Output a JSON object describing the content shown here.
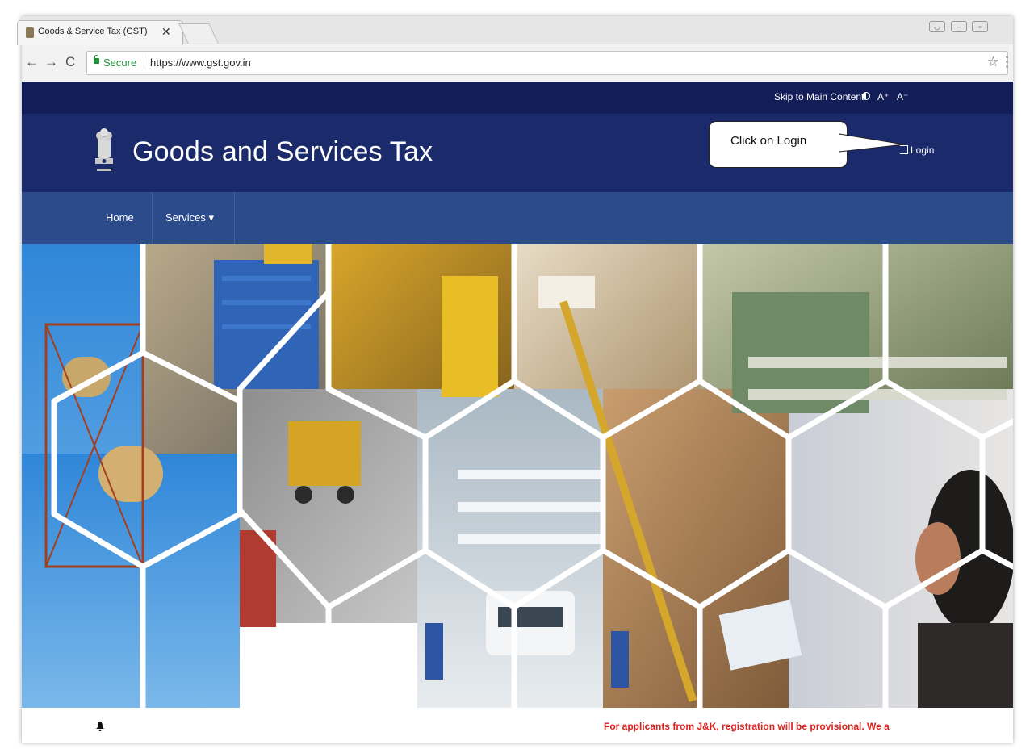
{
  "browser": {
    "tab_title": "Goods & Service Tax (GST)",
    "tab_close": "✕",
    "back": "←",
    "forward": "→",
    "reload": "C",
    "secure_label": "Secure",
    "url": "https://www.gst.gov.in",
    "bookmark_icon": "☆",
    "menu_icon": "⋮"
  },
  "site": {
    "skip_link": "Skip to Main Content",
    "font_increase": "A⁺",
    "font_decrease": "A⁻",
    "title": "Goods and Services Tax",
    "login_label": "Login",
    "nav": {
      "home": "Home",
      "services": "Services ▾"
    },
    "ticker": "For applicants from J&K, registration will be provisional. We a"
  },
  "annotation": {
    "callout_text": "Click on Login"
  },
  "colors": {
    "topbar": "#131e58",
    "header": "#1b2a6b",
    "navbar": "#2c4b8b",
    "ticker_text": "#d8231f",
    "secure_green": "#1f8f3a"
  }
}
